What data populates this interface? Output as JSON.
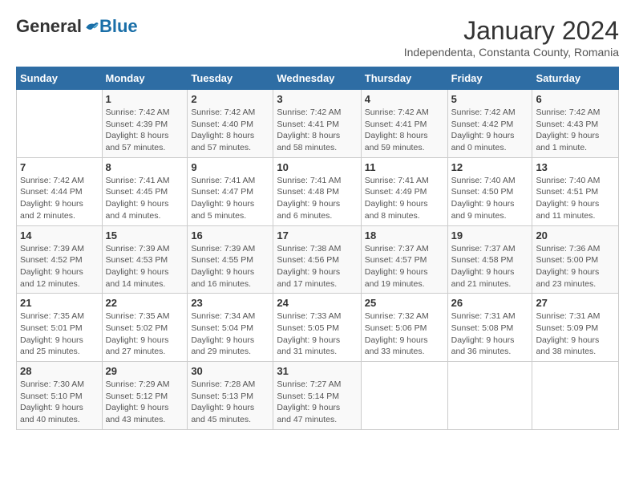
{
  "header": {
    "logo_general": "General",
    "logo_blue": "Blue",
    "month_title": "January 2024",
    "subtitle": "Independenta, Constanta County, Romania"
  },
  "days_of_week": [
    "Sunday",
    "Monday",
    "Tuesday",
    "Wednesday",
    "Thursday",
    "Friday",
    "Saturday"
  ],
  "weeks": [
    [
      {
        "day": "",
        "detail": ""
      },
      {
        "day": "1",
        "detail": "Sunrise: 7:42 AM\nSunset: 4:39 PM\nDaylight: 8 hours\nand 57 minutes."
      },
      {
        "day": "2",
        "detail": "Sunrise: 7:42 AM\nSunset: 4:40 PM\nDaylight: 8 hours\nand 57 minutes."
      },
      {
        "day": "3",
        "detail": "Sunrise: 7:42 AM\nSunset: 4:41 PM\nDaylight: 8 hours\nand 58 minutes."
      },
      {
        "day": "4",
        "detail": "Sunrise: 7:42 AM\nSunset: 4:41 PM\nDaylight: 8 hours\nand 59 minutes."
      },
      {
        "day": "5",
        "detail": "Sunrise: 7:42 AM\nSunset: 4:42 PM\nDaylight: 9 hours\nand 0 minutes."
      },
      {
        "day": "6",
        "detail": "Sunrise: 7:42 AM\nSunset: 4:43 PM\nDaylight: 9 hours\nand 1 minute."
      }
    ],
    [
      {
        "day": "7",
        "detail": "Sunrise: 7:42 AM\nSunset: 4:44 PM\nDaylight: 9 hours\nand 2 minutes."
      },
      {
        "day": "8",
        "detail": "Sunrise: 7:41 AM\nSunset: 4:45 PM\nDaylight: 9 hours\nand 4 minutes."
      },
      {
        "day": "9",
        "detail": "Sunrise: 7:41 AM\nSunset: 4:47 PM\nDaylight: 9 hours\nand 5 minutes."
      },
      {
        "day": "10",
        "detail": "Sunrise: 7:41 AM\nSunset: 4:48 PM\nDaylight: 9 hours\nand 6 minutes."
      },
      {
        "day": "11",
        "detail": "Sunrise: 7:41 AM\nSunset: 4:49 PM\nDaylight: 9 hours\nand 8 minutes."
      },
      {
        "day": "12",
        "detail": "Sunrise: 7:40 AM\nSunset: 4:50 PM\nDaylight: 9 hours\nand 9 minutes."
      },
      {
        "day": "13",
        "detail": "Sunrise: 7:40 AM\nSunset: 4:51 PM\nDaylight: 9 hours\nand 11 minutes."
      }
    ],
    [
      {
        "day": "14",
        "detail": "Sunrise: 7:39 AM\nSunset: 4:52 PM\nDaylight: 9 hours\nand 12 minutes."
      },
      {
        "day": "15",
        "detail": "Sunrise: 7:39 AM\nSunset: 4:53 PM\nDaylight: 9 hours\nand 14 minutes."
      },
      {
        "day": "16",
        "detail": "Sunrise: 7:39 AM\nSunset: 4:55 PM\nDaylight: 9 hours\nand 16 minutes."
      },
      {
        "day": "17",
        "detail": "Sunrise: 7:38 AM\nSunset: 4:56 PM\nDaylight: 9 hours\nand 17 minutes."
      },
      {
        "day": "18",
        "detail": "Sunrise: 7:37 AM\nSunset: 4:57 PM\nDaylight: 9 hours\nand 19 minutes."
      },
      {
        "day": "19",
        "detail": "Sunrise: 7:37 AM\nSunset: 4:58 PM\nDaylight: 9 hours\nand 21 minutes."
      },
      {
        "day": "20",
        "detail": "Sunrise: 7:36 AM\nSunset: 5:00 PM\nDaylight: 9 hours\nand 23 minutes."
      }
    ],
    [
      {
        "day": "21",
        "detail": "Sunrise: 7:35 AM\nSunset: 5:01 PM\nDaylight: 9 hours\nand 25 minutes."
      },
      {
        "day": "22",
        "detail": "Sunrise: 7:35 AM\nSunset: 5:02 PM\nDaylight: 9 hours\nand 27 minutes."
      },
      {
        "day": "23",
        "detail": "Sunrise: 7:34 AM\nSunset: 5:04 PM\nDaylight: 9 hours\nand 29 minutes."
      },
      {
        "day": "24",
        "detail": "Sunrise: 7:33 AM\nSunset: 5:05 PM\nDaylight: 9 hours\nand 31 minutes."
      },
      {
        "day": "25",
        "detail": "Sunrise: 7:32 AM\nSunset: 5:06 PM\nDaylight: 9 hours\nand 33 minutes."
      },
      {
        "day": "26",
        "detail": "Sunrise: 7:31 AM\nSunset: 5:08 PM\nDaylight: 9 hours\nand 36 minutes."
      },
      {
        "day": "27",
        "detail": "Sunrise: 7:31 AM\nSunset: 5:09 PM\nDaylight: 9 hours\nand 38 minutes."
      }
    ],
    [
      {
        "day": "28",
        "detail": "Sunrise: 7:30 AM\nSunset: 5:10 PM\nDaylight: 9 hours\nand 40 minutes."
      },
      {
        "day": "29",
        "detail": "Sunrise: 7:29 AM\nSunset: 5:12 PM\nDaylight: 9 hours\nand 43 minutes."
      },
      {
        "day": "30",
        "detail": "Sunrise: 7:28 AM\nSunset: 5:13 PM\nDaylight: 9 hours\nand 45 minutes."
      },
      {
        "day": "31",
        "detail": "Sunrise: 7:27 AM\nSunset: 5:14 PM\nDaylight: 9 hours\nand 47 minutes."
      },
      {
        "day": "",
        "detail": ""
      },
      {
        "day": "",
        "detail": ""
      },
      {
        "day": "",
        "detail": ""
      }
    ]
  ]
}
